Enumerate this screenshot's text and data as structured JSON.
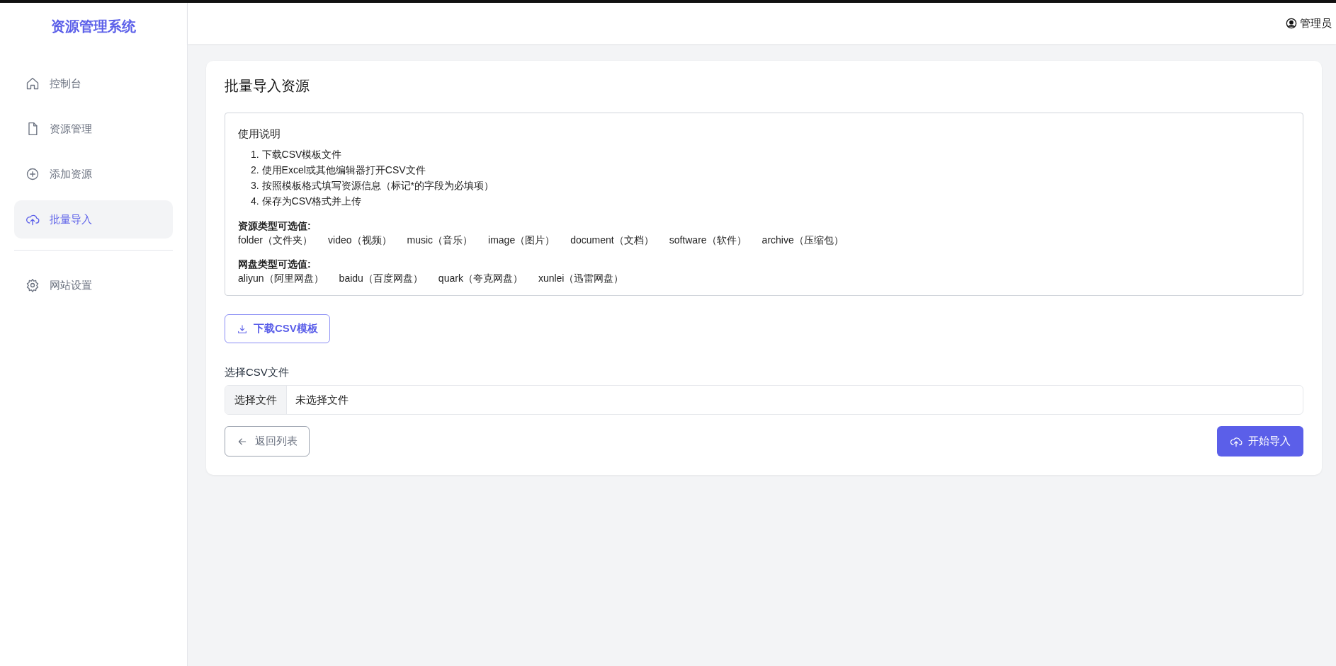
{
  "sidebar": {
    "title": "资源管理系统",
    "items": [
      {
        "label": "控制台",
        "selected": false
      },
      {
        "label": "资源管理",
        "selected": false
      },
      {
        "label": "添加资源",
        "selected": false
      },
      {
        "label": "批量导入",
        "selected": true
      }
    ],
    "bottom_items": [
      {
        "label": "网站设置",
        "selected": false
      }
    ]
  },
  "header": {
    "user": "管理员"
  },
  "page": {
    "title": "批量导入资源",
    "instructions": {
      "title": "使用说明",
      "steps": [
        "1. 下载CSV模板文件",
        "2. 使用Excel或其他编辑器打开CSV文件",
        "3. 按照模板格式填写资源信息（标记*的字段为必填项）",
        "4. 保存为CSV格式并上传"
      ],
      "groups": [
        {
          "title": "资源类型可选值:",
          "values": [
            "folder（文件夹）",
            "video（视频）",
            "music（音乐）",
            "image（图片）",
            "document（文档）",
            "software（软件）",
            "archive（压缩包）"
          ]
        },
        {
          "title": "网盘类型可选值:",
          "values": [
            "aliyun（阿里网盘）",
            "baidu（百度网盘）",
            "quark（夸克网盘）",
            "xunlei（迅雷网盘）"
          ]
        }
      ]
    },
    "download_button": "下载CSV模板",
    "file_label": "选择CSV文件",
    "file_input": {
      "button": "选择文件",
      "value": "未选择文件"
    },
    "back_button": "返回列表",
    "submit_button": "开始导入"
  }
}
